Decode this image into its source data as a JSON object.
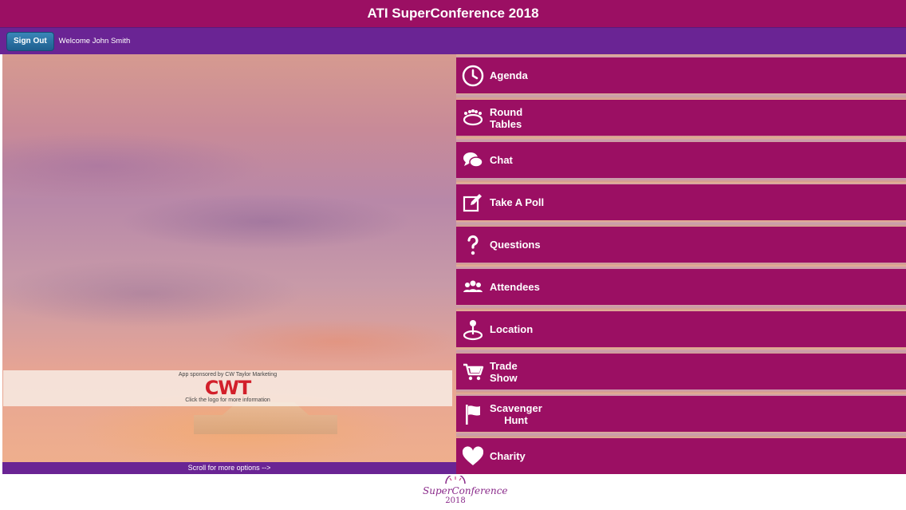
{
  "header": {
    "title": "ATI SuperConference 2018"
  },
  "user_bar": {
    "sign_out_label": "Sign Out",
    "welcome_text": "Welcome John Smith"
  },
  "hero": {
    "sponsor_text": "App sponsored by CW Taylor Marketing",
    "sponsor_logo": "CWT",
    "sponsor_hint": "Click the logo for more information",
    "scroll_hint": "Scroll for more options -->"
  },
  "menu": {
    "items": [
      {
        "label": "Agenda",
        "icon": "clock-icon"
      },
      {
        "label": "Round\nTables",
        "icon": "round-table-icon"
      },
      {
        "label": "Chat",
        "icon": "chat-bubbles-icon"
      },
      {
        "label": "Take A Poll",
        "icon": "edit-icon"
      },
      {
        "label": "Questions",
        "icon": "question-icon"
      },
      {
        "label": "Attendees",
        "icon": "people-icon"
      },
      {
        "label": "Location",
        "icon": "map-pin-icon"
      },
      {
        "label": "Trade\nShow",
        "icon": "cart-icon"
      },
      {
        "label": "Scavenger\nHunt",
        "icon": "flag-icon"
      },
      {
        "label": "Charity",
        "icon": "heart-icon"
      }
    ]
  },
  "footer": {
    "logo_text": "SuperConference",
    "logo_year": "2018"
  },
  "colors": {
    "title_bar": "#9b0f63",
    "user_bar": "#6a2494",
    "menu_button": "#9b0f63",
    "sign_out": "#1e5f8f"
  }
}
